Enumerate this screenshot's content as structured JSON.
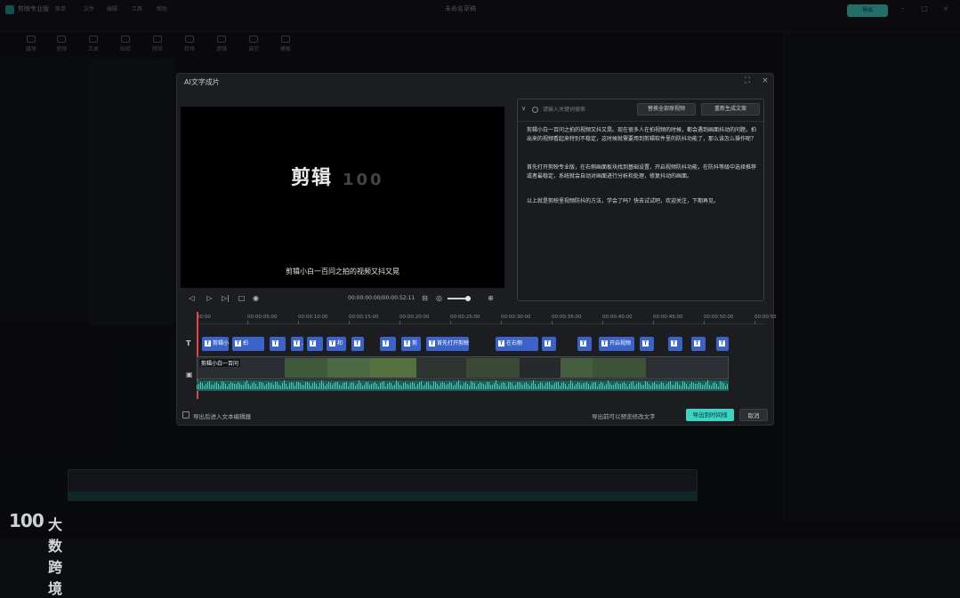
{
  "app": {
    "brand": "剪映专业版",
    "title": "未命名草稿",
    "export_label": "导出",
    "menu": [
      "菜单",
      "文件",
      "编辑",
      "工具",
      "帮助"
    ]
  },
  "toolbar": [
    "媒体",
    "音频",
    "文本",
    "贴纸",
    "特效",
    "转场",
    "滤镜",
    "调节",
    "模板"
  ],
  "dialog": {
    "title": "AI文字成片",
    "preview": {
      "logo_text": "剪辑",
      "logo_num": "100",
      "subtitle": "剪辑小白一百问之拍的视频又抖又晃"
    },
    "player": {
      "timecode": "00:00:00:00/00:00:52:11"
    },
    "text_panel": {
      "search_placeholder": "请输入关键词搜索",
      "btn_replace": "替换全部原视频",
      "btn_regen": "重新生成文案",
      "paragraphs": [
        "剪辑小白一百问之拍的视频又抖又晃。现在很多人在拍视频的时候，都会遇到画面抖动的问题，拍出来的视频看起来特别不稳定，这时候就需要用到剪辑软件里的防抖功能了，那么该怎么操作呢？",
        "首先打开剪映专业版，在右侧画面板块找到基础设置，开启视频防抖功能，在防抖等级中选择推荐或者最稳定，系统就会自动对画面进行分析和处理，修复抖动的画面。",
        "以上就是剪映里视频防抖的方法，学会了吗？快去试试吧，欢迎关注，下期再见。"
      ]
    },
    "ruler_ticks": [
      "00:00",
      "00:00:05:00",
      "00:00:10:00",
      "00:00:15:00",
      "00:00:20:00",
      "00:00:25:00",
      "00:00:30:00",
      "00:00:35:00",
      "00:00:40:00",
      "00:00:45:00",
      "00:00:50:00",
      "00:00:55"
    ],
    "track_labels": {
      "text": "T"
    },
    "text_clips": [
      {
        "label": "剪辑小白"
      },
      {
        "label": "拍"
      },
      {
        "label": ""
      },
      {
        "label": "..."
      },
      {
        "label": ""
      },
      {
        "label": "和"
      },
      {
        "label": ""
      },
      {
        "label": ""
      },
      {
        "label": "剪"
      },
      {
        "label": "首先打开剪映"
      },
      {
        "label": "在右侧"
      },
      {
        "label": ""
      },
      {
        "label": ""
      },
      {
        "label": "开启视频"
      },
      {
        "label": ""
      },
      {
        "label": ""
      },
      {
        "label": ""
      },
      {
        "label": ""
      }
    ],
    "video_track_label": "剪辑小白一百问",
    "footer": {
      "checkbox_label": "导出后进入文本编辑器",
      "info": "导出前可以预览修改文字",
      "primary": "导出到时间线",
      "cancel": "取消"
    }
  },
  "watermark": {
    "logo": "100",
    "text": "大数跨境"
  },
  "colors": {
    "accent": "#3fd2c3",
    "text_clip": "#3a62c9",
    "audio": "#47c9b4",
    "playhead": "#e0484a"
  }
}
